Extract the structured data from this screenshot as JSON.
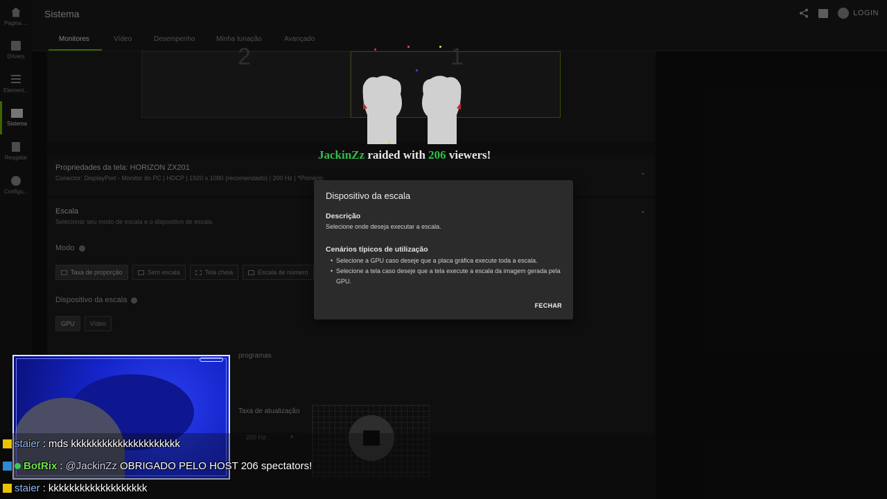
{
  "window": {
    "title": "Sistema"
  },
  "sidebar": {
    "items": [
      {
        "label": "Página ...",
        "icon": "home-icon",
        "active": false
      },
      {
        "label": "Drivers",
        "icon": "drivers-icon",
        "active": false
      },
      {
        "label": "Element...",
        "icon": "sliders-icon",
        "active": false
      },
      {
        "label": "Sistema",
        "icon": "system-icon",
        "active": true
      },
      {
        "label": "Resgatar",
        "icon": "gift-icon",
        "active": false
      },
      {
        "label": "Configu...",
        "icon": "gear-icon",
        "active": false
      }
    ]
  },
  "header": {
    "login": "LOGIN",
    "icons": [
      "share-icon",
      "feedback-icon",
      "user-avatar-icon"
    ]
  },
  "tabs": [
    "Monitores",
    "Vídeo",
    "Desempenho",
    "Minha tunação",
    "Avançado"
  ],
  "monitors": {
    "left_number": "2",
    "right_number": "1"
  },
  "properties": {
    "title": "Propriedades da tela: HORIZON ZX201",
    "subtitle": "Conector: DisplayPort - Monitor do PC | HDCP | 1920 x 1080 (recomendado) | 200 Hz | *Primário"
  },
  "scale": {
    "title": "Escala",
    "subtitle": "Selecionar seu modo de escala e o dispositivo de escala",
    "mode_label": "Modo",
    "mode_options": [
      "Taxa de proporção",
      "Sem escala",
      "Tela cheia",
      "Escala de número"
    ],
    "device_label": "Dispositivo da escala",
    "device_options": [
      "GPU",
      "Vídeo"
    ],
    "checkbox_text": "programas",
    "refresh_label": "Taxa de atualização",
    "refresh_value": "200 Hz"
  },
  "dialog": {
    "title": "Dispositivo da escala",
    "desc_heading": "Descrição",
    "desc_text": "Selecione onde deseja executar a escala.",
    "usage_heading": "Cenários típicos de utilização",
    "usage_items": [
      "Selecione a GPU caso deseje que a placa gráfica execute toda a escala.",
      "Selecione a tela caso deseje que a tela execute a escala da imagem gerada pela GPU."
    ],
    "close_label": "FECHAR"
  },
  "raid": {
    "user": "JackinZz",
    "text1": "raided with",
    "count": "206",
    "text2": "viewers!"
  },
  "chat": [
    {
      "user": "staier",
      "sep": " : ",
      "mention": "",
      "message": "mds kkkkkkkkkkkkkkkkkkkkk",
      "badge": "crown"
    },
    {
      "user": "BotRix",
      "sep": " : ",
      "mention": "@JackinZz",
      "message": " OBRIGADO PELO HOST 206 spectators!",
      "badge": "bot"
    },
    {
      "user": "staier",
      "sep": " : ",
      "mention": "",
      "message": "kkkkkkkkkkkkkkkkkkk",
      "badge": "crown"
    }
  ],
  "colors": {
    "accent": "#76b900",
    "raid_green": "#2fbf4a",
    "dialog_bg": "#2b2b2b"
  }
}
